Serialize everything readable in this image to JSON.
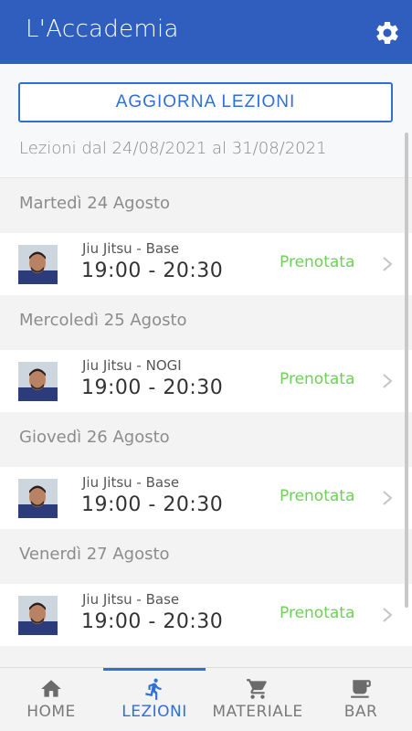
{
  "app": {
    "title": "L'Accademia"
  },
  "header": {
    "settings_icon": "gear-icon"
  },
  "main": {
    "refresh_label": "AGGIORNA LEZIONI",
    "range_text": "Lezioni dal 24/08/2021 al 31/08/2021",
    "days": [
      {
        "label": "Martedì 24 Agosto",
        "lesson": {
          "course": "Jiu Jitsu - Base",
          "time": "19:00 - 20:30",
          "status": "Prenotata"
        }
      },
      {
        "label": "Mercoledì 25 Agosto",
        "lesson": {
          "course": "Jiu Jitsu - NOGI",
          "time": "19:00 - 20:30",
          "status": "Prenotata"
        }
      },
      {
        "label": "Giovedì 26 Agosto",
        "lesson": {
          "course": "Jiu Jitsu - Base",
          "time": "19:00 - 20:30",
          "status": "Prenotata"
        }
      },
      {
        "label": "Venerdì 27 Agosto",
        "lesson": {
          "course": "Jiu Jitsu - Base",
          "time": "19:00 - 20:30",
          "status": "Prenotata"
        }
      }
    ]
  },
  "nav": {
    "items": [
      {
        "label": "HOME",
        "icon": "home-icon"
      },
      {
        "label": "LEZIONI",
        "icon": "running-person-icon"
      },
      {
        "label": "MATERIALE",
        "icon": "cart-icon"
      },
      {
        "label": "BAR",
        "icon": "coffee-cup-icon"
      }
    ],
    "active_index": 1
  },
  "colors": {
    "primary": "#2f5ebf",
    "accent": "#2f6fd6",
    "status_booked": "#6fcf57",
    "background": "#f3f3f3"
  }
}
